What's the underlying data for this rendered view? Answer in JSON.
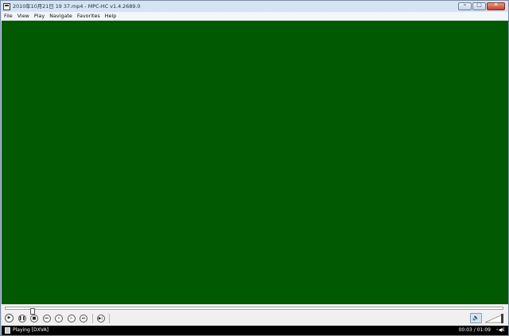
{
  "window": {
    "title": "2010年10月21日 19 37.mp4 - MPC-HC v1.4.2689.0"
  },
  "menu": [
    "File",
    "View",
    "Play",
    "Navigate",
    "Favorites",
    "Help"
  ],
  "playback": {
    "seek_position": 0.05
  },
  "status": {
    "text": "Playing [DXVA]",
    "time": "00:03 / 01:09"
  },
  "colors": {
    "video_background": "#015a01"
  }
}
